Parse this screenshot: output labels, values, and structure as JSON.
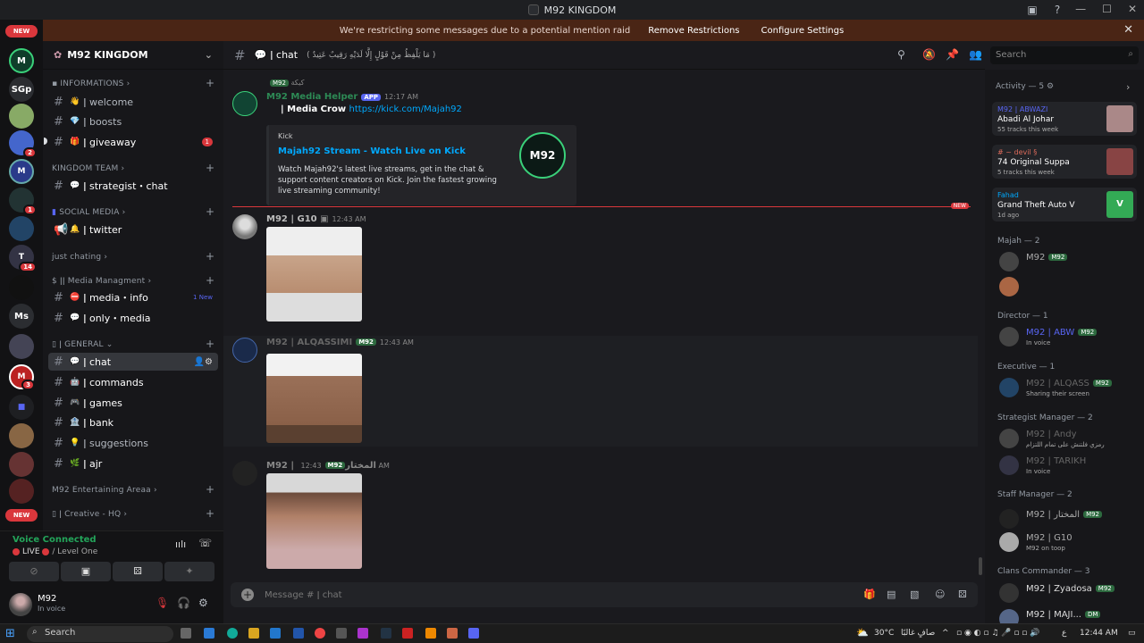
{
  "window": {
    "title": "M92 KINGDOM"
  },
  "notice": {
    "text": "We're restricting some messages due to a potential mention raid",
    "remove": "Remove Restrictions",
    "configure": "Configure Settings"
  },
  "rail": {
    "new_top": "NEW",
    "new_bottom": "NEW",
    "sgp": "SGp",
    "ms": "Ms",
    "badges": [
      "2",
      "1",
      "14",
      "3"
    ]
  },
  "server": {
    "name": "M92 KINGDOM"
  },
  "categories": {
    "informations": "INFORMATIONS",
    "kingdom_team": "KINGDOM TEAM",
    "social_media": "SOCIAL MEDIA",
    "just_chating": "just chating",
    "media_management": "Media Managment",
    "general": "GENERAL",
    "entertaining": "M92 Entertaining Areaa",
    "creative": "Creative - HQ"
  },
  "channels": {
    "welcome": "welcome",
    "boosts": "boosts",
    "giveaway": "giveaway",
    "giveaway_count": "1",
    "strategist_chat": "strategist・chat",
    "twitter": "twitter",
    "media_info": "media・info",
    "media_info_new": "1 New",
    "only_media": "only・media",
    "chat": "chat",
    "commands": "commands",
    "games": "games",
    "bank": "bank",
    "suggestions": "suggestions",
    "ajr": "ajr"
  },
  "voice": {
    "connected": "Voice Connected",
    "live": "LIVE",
    "level": "Level One"
  },
  "user": {
    "name": "M92",
    "status": "In voice"
  },
  "header": {
    "channel": "chat",
    "topic": "( مَا يَلْفِظُ مِنْ قَوْلٍ إِلَّا لَدَيْهِ رَقِيبٌ عَتِيدٌ )",
    "search_placeholder": "Search"
  },
  "messages": {
    "m0": {
      "author": "M92 Media Helper",
      "app": "APP",
      "time": "12:17 AM",
      "reply_tag": "M92",
      "reply_text": "كيكة",
      "line_prefix": "| Media Crow",
      "link": "https://kick.com/Majah92",
      "embed": {
        "provider": "Kick",
        "title": "Majah92 Stream - Watch Live on Kick",
        "desc": "Watch Majah92's latest live streams, get in the chat & support content creators on Kick. Join the fastest growing live streaming community!",
        "thumb": "M92"
      }
    },
    "new_label": "NEW",
    "m1": {
      "author": "M92 | G10",
      "time": "12:43 AM"
    },
    "m2": {
      "author": "M92 | ALQASSIMI",
      "tag": "M92",
      "time": "12:43 AM"
    },
    "m3": {
      "author": "M92 | المختار",
      "tag": "M92",
      "time": "12:43 AM"
    }
  },
  "composer": {
    "placeholder": "Message #  ǀ chat"
  },
  "activity": {
    "header": "Activity — 5",
    "items": [
      {
        "name": "M92 | ABWAZI",
        "title": "Abadi Al Johar",
        "sub": "55 tracks this week"
      },
      {
        "name": "# ~ devil §",
        "title": "74 Original Suppa",
        "sub": "5 tracks this week"
      },
      {
        "name": "Fahad",
        "title": "Grand Theft Auto V",
        "sub": "1d ago"
      }
    ]
  },
  "roles": [
    {
      "label": "Majah — 2"
    },
    {
      "label": "Director — 1"
    },
    {
      "label": "Executive — 1"
    },
    {
      "label": "Strategist Manager — 2"
    },
    {
      "label": "Staff Manager — 2"
    },
    {
      "label": "Clans Commander — 3"
    }
  ],
  "members": {
    "majah1": {
      "name": "M92",
      "tag": "M92"
    },
    "director": {
      "name": "M92 | ABW",
      "status": "In voice",
      "tag": "M92"
    },
    "executive": {
      "name": "M92 | ALQASS",
      "status": "Sharing their screen",
      "tag": "M92"
    },
    "strat1": {
      "name": "M92 | Andy",
      "status": "رمزي فلتنش على تمام اللتزام"
    },
    "strat2": {
      "name": "M92 | TARIKH",
      "status": "In voice"
    },
    "staff1": {
      "name": "M92 | المختار",
      "tag": "M92"
    },
    "staff2": {
      "name": "M92 | G10",
      "status": "M92 on toop"
    },
    "clan1": {
      "name": "M92 | Zyadosa",
      "tag": "M92"
    },
    "clan2": {
      "name": "M92 | MAJI...",
      "tag": "DM"
    }
  },
  "taskbar": {
    "search": "Search",
    "weather": "30°C",
    "weather_text": "صافٍ غالبًا",
    "lang": "ع",
    "time": "12:44 AM"
  },
  "colors": {
    "accent": "#5865f2",
    "danger": "#da373c",
    "online": "#23a55a",
    "notice_bg": "#4a2515"
  }
}
